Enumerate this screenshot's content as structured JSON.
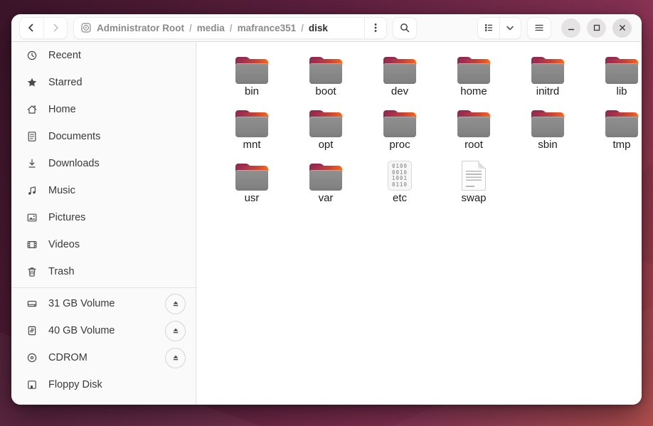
{
  "colors": {
    "accent_orange": "#ee5c20",
    "folder_magenta": "#9c2d50",
    "folder_gray": "#8a8a8a",
    "headerbar_bg": "#fafafa",
    "wallpaper_dark": "#3d152b",
    "wallpaper_red": "#b24b4a"
  },
  "headerbar": {
    "back_button": "back",
    "forward_button": "forward",
    "breadcrumb": {
      "root_icon": "disc-icon",
      "root_label": "Administrator Root",
      "separator": "/",
      "segments": [
        "media",
        "mafrance351"
      ],
      "current": "disk"
    },
    "menu_kebab": "location-menu",
    "search_button": "search",
    "view_toggle": "list-view",
    "hamburger": "main-menu",
    "window_controls": {
      "minimize": "minimize",
      "maximize": "maximize",
      "close": "close"
    }
  },
  "sidebar": {
    "items": [
      {
        "label": "Recent",
        "icon": "clock-icon"
      },
      {
        "label": "Starred",
        "icon": "star-icon"
      },
      {
        "label": "Home",
        "icon": "home-icon"
      },
      {
        "label": "Documents",
        "icon": "document-icon"
      },
      {
        "label": "Downloads",
        "icon": "download-icon"
      },
      {
        "label": "Music",
        "icon": "music-note-icon"
      },
      {
        "label": "Pictures",
        "icon": "picture-icon"
      },
      {
        "label": "Videos",
        "icon": "video-icon"
      },
      {
        "label": "Trash",
        "icon": "trash-icon"
      }
    ],
    "volumes": [
      {
        "label": "31 GB Volume",
        "icon": "harddisk-icon",
        "eject": true
      },
      {
        "label": "40 GB Volume",
        "icon": "usb-drive-icon",
        "eject": true
      },
      {
        "label": "CDROM",
        "icon": "optical-disc-icon",
        "eject": true
      },
      {
        "label": "Floppy Disk",
        "icon": "floppy-icon",
        "eject": false
      }
    ]
  },
  "content": {
    "items": [
      {
        "name": "bin",
        "type": "folder"
      },
      {
        "name": "boot",
        "type": "folder"
      },
      {
        "name": "dev",
        "type": "folder"
      },
      {
        "name": "home",
        "type": "folder"
      },
      {
        "name": "initrd",
        "type": "folder"
      },
      {
        "name": "lib",
        "type": "folder"
      },
      {
        "name": "mnt",
        "type": "folder"
      },
      {
        "name": "opt",
        "type": "folder"
      },
      {
        "name": "proc",
        "type": "folder"
      },
      {
        "name": "root",
        "type": "folder"
      },
      {
        "name": "sbin",
        "type": "folder"
      },
      {
        "name": "tmp",
        "type": "folder"
      },
      {
        "name": "usr",
        "type": "folder"
      },
      {
        "name": "var",
        "type": "folder"
      },
      {
        "name": "etc",
        "type": "binary",
        "digits": [
          "0100",
          "0010",
          "1001",
          "0110"
        ]
      },
      {
        "name": "swap",
        "type": "document"
      }
    ]
  }
}
